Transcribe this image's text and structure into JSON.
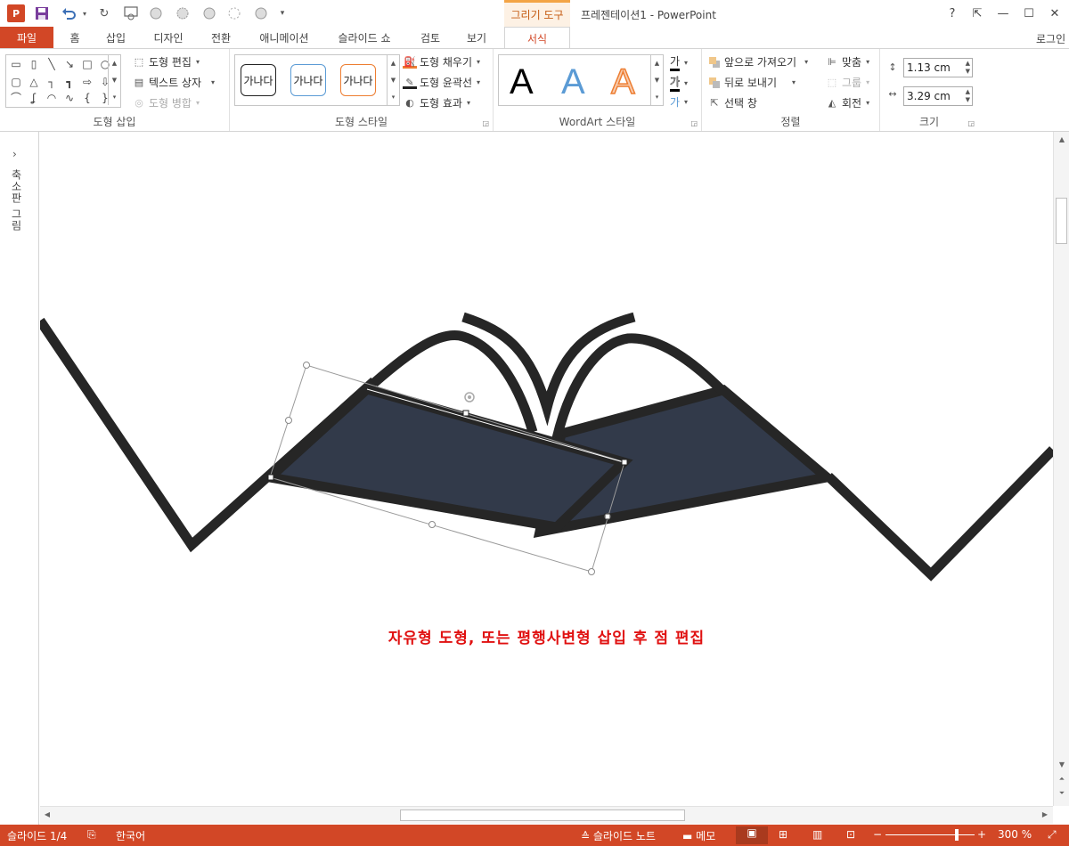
{
  "title_bar": {
    "app_logo": "P",
    "context_tab": "그리기 도구",
    "window_title": "프레젠테이션1 - PowerPoint",
    "help": "?",
    "ribbon_display": "⇱",
    "minimize": "—",
    "maximize": "☐",
    "close": "✕"
  },
  "tabs": {
    "file": "파일",
    "items": [
      "홈",
      "삽입",
      "디자인",
      "전환",
      "애니메이션",
      "슬라이드 쇼",
      "검토",
      "보기"
    ],
    "format": "서식",
    "login": "로그인"
  },
  "ribbon": {
    "insert_shapes": {
      "label": "도형 삽입",
      "edit_shape": "도형 편집",
      "text_box": "텍스트 상자",
      "merge_shapes": "도형 병합"
    },
    "shape_styles": {
      "label": "도형 스타일",
      "swatch_text": "가나다",
      "fill": "도형 채우기",
      "outline": "도형 윤곽선",
      "effects": "도형 효과"
    },
    "wordart_styles": {
      "label": "WordArt 스타일",
      "letter": "A",
      "text_fill_glyph": "가",
      "text_outline_glyph": "가",
      "text_effects_glyph": "가"
    },
    "arrange": {
      "label": "정렬",
      "bring_forward": "앞으로 가져오기",
      "send_backward": "뒤로 보내기",
      "selection_pane": "선택 창",
      "align": "맞춤",
      "group": "그룹",
      "rotate": "회전"
    },
    "size": {
      "label": "크기",
      "height": "1.13 cm",
      "width": "3.29 cm"
    }
  },
  "thumb_pane": {
    "toggle": "›",
    "label": "축소판 그림"
  },
  "slide": {
    "caption": "자유형 도형, 또는 평행사변형 삽입 후 점 편집",
    "stroke_color": "#262626",
    "fill_color": "#323a4a",
    "caption_color": "#e01010"
  },
  "status": {
    "slide_info": "슬라이드 1/4",
    "language": "한국어",
    "notes": "슬라이드 노트",
    "comments": "메모",
    "zoom_minus": "−",
    "zoom_plus": "+",
    "zoom": "300 %"
  },
  "colors": {
    "accent": "#d24726",
    "context_accent": "#c55a11"
  }
}
